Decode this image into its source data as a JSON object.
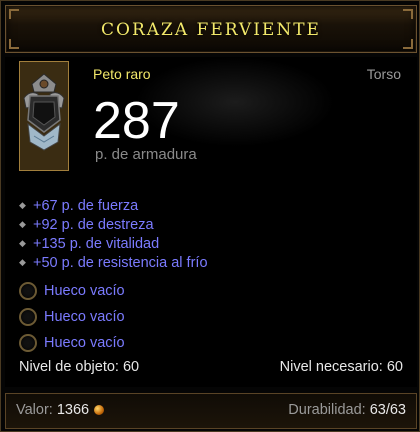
{
  "item": {
    "name": "CORAZA FERVIENTE",
    "type": "Peto raro",
    "slot": "Torso",
    "armor": "287",
    "armor_label": "p. de armadura",
    "icon": "chest-armor-icon"
  },
  "stats": [
    {
      "text": "+67 p. de fuerza"
    },
    {
      "text": "+92 p. de destreza"
    },
    {
      "text": "+135 p. de vitalidad"
    },
    {
      "text": "+50 p. de resistencia al frío"
    }
  ],
  "sockets": [
    {
      "label": "Hueco vacío"
    },
    {
      "label": "Hueco vacío"
    },
    {
      "label": "Hueco vacío"
    }
  ],
  "levels": {
    "item_level": "Nivel de objeto: 60",
    "required_level": "Nivel necesario: 60"
  },
  "footer": {
    "value_label": "Valor:",
    "value": "1366",
    "durability_label": "Durabilidad:",
    "durability": "63/63"
  },
  "colors": {
    "title": "#f2e86a",
    "magic_stat": "#7b7bff",
    "rare_type": "#f2e86a"
  }
}
